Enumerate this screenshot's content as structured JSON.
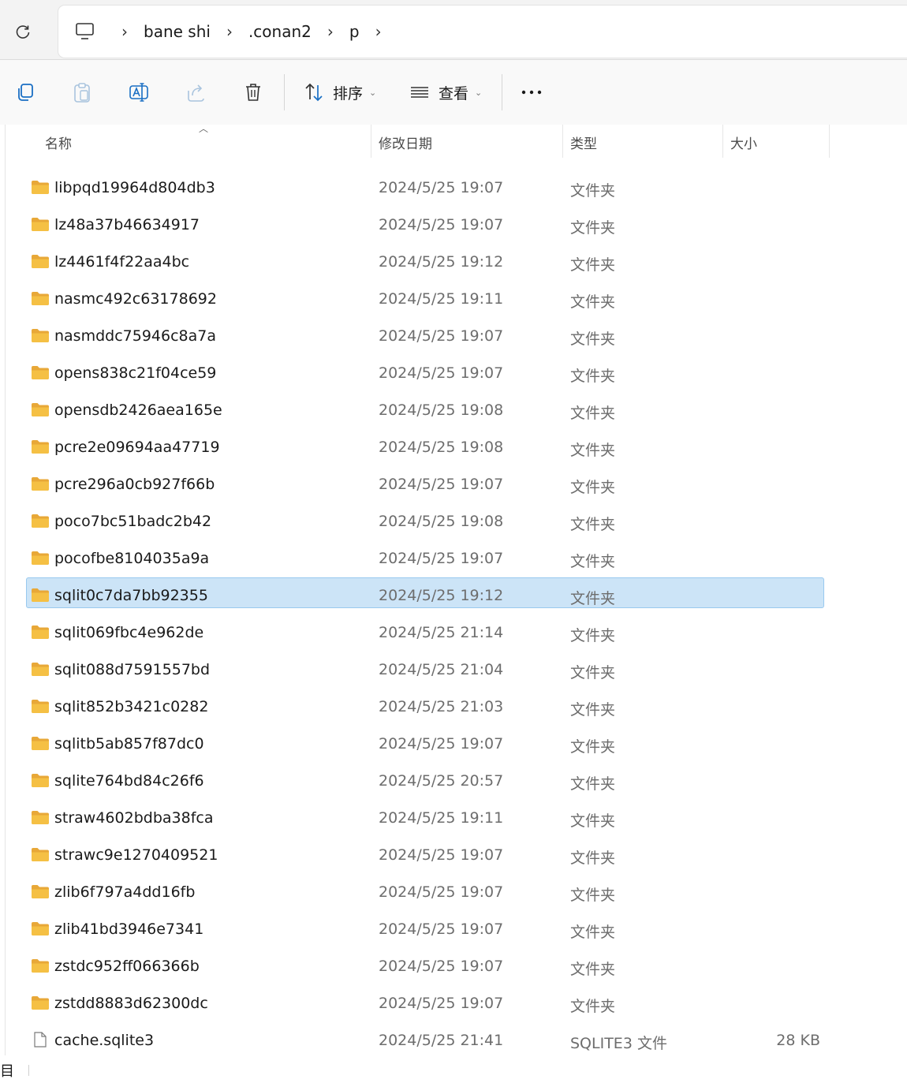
{
  "breadcrumb": {
    "items": [
      "bane shi",
      ".conan2",
      "p"
    ],
    "separator": "›"
  },
  "toolbar": {
    "sort_label": "排序",
    "view_label": "查看",
    "more_label": "···"
  },
  "columns": {
    "name": "名称",
    "date": "修改日期",
    "type": "类型",
    "size": "大小"
  },
  "rows": [
    {
      "name": "libpqd19964d804db3",
      "date": "2024/5/25 19:07",
      "type": "文件夹",
      "size": "",
      "kind": "folder"
    },
    {
      "name": "lz48a37b46634917",
      "date": "2024/5/25 19:07",
      "type": "文件夹",
      "size": "",
      "kind": "folder"
    },
    {
      "name": "lz4461f4f22aa4bc",
      "date": "2024/5/25 19:12",
      "type": "文件夹",
      "size": "",
      "kind": "folder"
    },
    {
      "name": "nasmc492c63178692",
      "date": "2024/5/25 19:11",
      "type": "文件夹",
      "size": "",
      "kind": "folder"
    },
    {
      "name": "nasmddc75946c8a7a",
      "date": "2024/5/25 19:07",
      "type": "文件夹",
      "size": "",
      "kind": "folder"
    },
    {
      "name": "opens838c21f04ce59",
      "date": "2024/5/25 19:07",
      "type": "文件夹",
      "size": "",
      "kind": "folder"
    },
    {
      "name": "opensdb2426aea165e",
      "date": "2024/5/25 19:08",
      "type": "文件夹",
      "size": "",
      "kind": "folder"
    },
    {
      "name": "pcre2e09694aa47719",
      "date": "2024/5/25 19:08",
      "type": "文件夹",
      "size": "",
      "kind": "folder"
    },
    {
      "name": "pcre296a0cb927f66b",
      "date": "2024/5/25 19:07",
      "type": "文件夹",
      "size": "",
      "kind": "folder"
    },
    {
      "name": "poco7bc51badc2b42",
      "date": "2024/5/25 19:08",
      "type": "文件夹",
      "size": "",
      "kind": "folder"
    },
    {
      "name": "pocofbe8104035a9a",
      "date": "2024/5/25 19:07",
      "type": "文件夹",
      "size": "",
      "kind": "folder"
    },
    {
      "name": "sqlit0c7da7bb92355",
      "date": "2024/5/25 19:12",
      "type": "文件夹",
      "size": "",
      "kind": "folder",
      "selected": true
    },
    {
      "name": "sqlit069fbc4e962de",
      "date": "2024/5/25 21:14",
      "type": "文件夹",
      "size": "",
      "kind": "folder"
    },
    {
      "name": "sqlit088d7591557bd",
      "date": "2024/5/25 21:04",
      "type": "文件夹",
      "size": "",
      "kind": "folder"
    },
    {
      "name": "sqlit852b3421c0282",
      "date": "2024/5/25 21:03",
      "type": "文件夹",
      "size": "",
      "kind": "folder"
    },
    {
      "name": "sqlitb5ab857f87dc0",
      "date": "2024/5/25 19:07",
      "type": "文件夹",
      "size": "",
      "kind": "folder"
    },
    {
      "name": "sqlite764bd84c26f6",
      "date": "2024/5/25 20:57",
      "type": "文件夹",
      "size": "",
      "kind": "folder"
    },
    {
      "name": "straw4602bdba38fca",
      "date": "2024/5/25 19:11",
      "type": "文件夹",
      "size": "",
      "kind": "folder"
    },
    {
      "name": "strawc9e1270409521",
      "date": "2024/5/25 19:07",
      "type": "文件夹",
      "size": "",
      "kind": "folder"
    },
    {
      "name": "zlib6f797a4dd16fb",
      "date": "2024/5/25 19:07",
      "type": "文件夹",
      "size": "",
      "kind": "folder"
    },
    {
      "name": "zlib41bd3946e7341",
      "date": "2024/5/25 19:07",
      "type": "文件夹",
      "size": "",
      "kind": "folder"
    },
    {
      "name": "zstdc952ff066366b",
      "date": "2024/5/25 19:07",
      "type": "文件夹",
      "size": "",
      "kind": "folder"
    },
    {
      "name": "zstdd8883d62300dc",
      "date": "2024/5/25 19:07",
      "type": "文件夹",
      "size": "",
      "kind": "folder"
    },
    {
      "name": "cache.sqlite3",
      "date": "2024/5/25 21:41",
      "type": "SQLITE3 文件",
      "size": "28 KB",
      "kind": "file"
    }
  ],
  "status": {
    "text": "目"
  },
  "colors": {
    "selection_bg": "#cce4f7",
    "selection_border": "#99c9ef",
    "folder_yellow": "#f5c044"
  }
}
